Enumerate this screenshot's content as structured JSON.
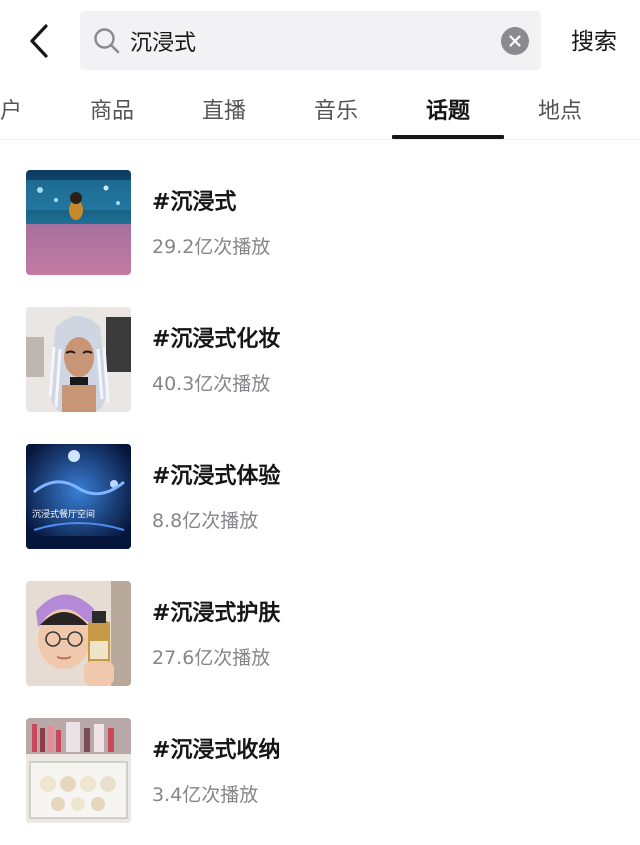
{
  "search": {
    "query": "沉浸式",
    "button_label": "搜索"
  },
  "tabs": [
    {
      "label": "户",
      "active": false
    },
    {
      "label": "商品",
      "active": false
    },
    {
      "label": "直播",
      "active": false
    },
    {
      "label": "音乐",
      "active": false
    },
    {
      "label": "话题",
      "active": true
    },
    {
      "label": "地点",
      "active": false
    }
  ],
  "topics": [
    {
      "title": "#沉浸式",
      "plays": "29.2亿次播放",
      "thumb_icon": "aquarium-thumbnail"
    },
    {
      "title": "#沉浸式化妆",
      "plays": "40.3亿次播放",
      "thumb_icon": "makeup-thumbnail"
    },
    {
      "title": "#沉浸式体验",
      "plays": "8.8亿次播放",
      "thumb_icon": "venue-thumbnail",
      "thumb_caption": "沉浸式餐厅空间"
    },
    {
      "title": "#沉浸式护肤",
      "plays": "27.6亿次播放",
      "thumb_icon": "skincare-thumbnail"
    },
    {
      "title": "#沉浸式收纳",
      "plays": "3.4亿次播放",
      "thumb_icon": "storage-thumbnail"
    }
  ],
  "colors": {
    "accent_text": "#161616",
    "secondary_text": "#86868a",
    "search_bg": "#f2f2f4"
  }
}
